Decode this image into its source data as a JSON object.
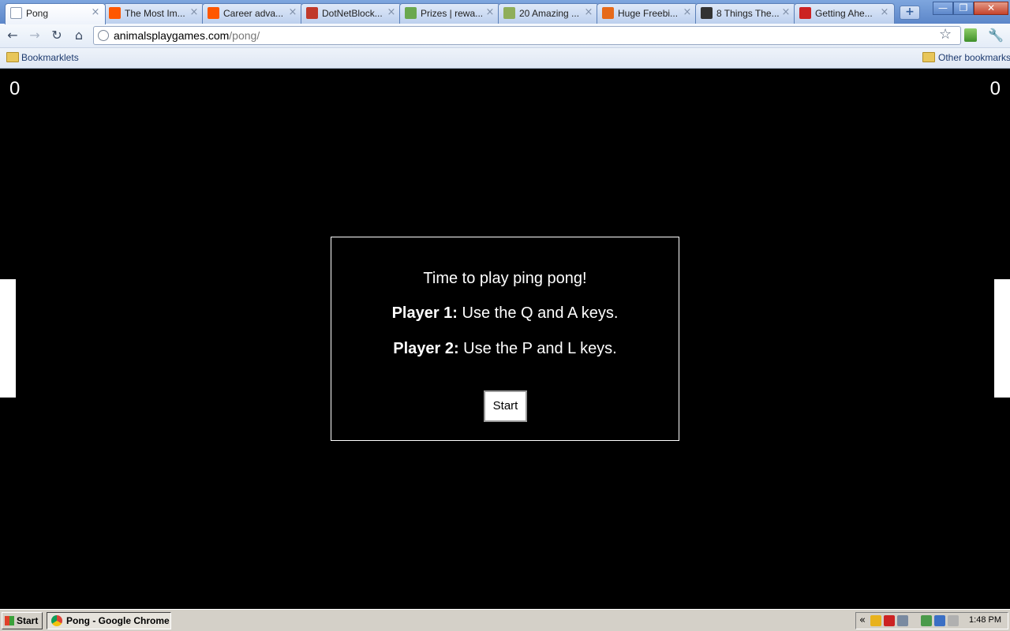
{
  "browser": {
    "tabs": [
      {
        "title": "Pong",
        "active": true,
        "icon": "page-icon",
        "icon_color": "#ffffff"
      },
      {
        "title": "The Most Im...",
        "active": false,
        "icon": "reddit-alien-icon",
        "icon_color": "#ff5700"
      },
      {
        "title": "Career adva...",
        "active": false,
        "icon": "reddit-alien-icon",
        "icon_color": "#ff5700"
      },
      {
        "title": "DotNetBlock...",
        "active": false,
        "icon": "key-icon",
        "icon_color": "#c0392b"
      },
      {
        "title": "Prizes | rewa...",
        "active": false,
        "icon": "prize-icon",
        "icon_color": "#6aa84f"
      },
      {
        "title": "20 Amazing ...",
        "active": false,
        "icon": "d-letter-icon",
        "icon_color": "#8fae5a"
      },
      {
        "title": "Huge Freebi...",
        "active": false,
        "icon": "flame-icon",
        "icon_color": "#e66a1a"
      },
      {
        "title": "8 Things The...",
        "active": false,
        "icon": "sr-icon",
        "icon_color": "#333333"
      },
      {
        "title": "Getting Ahe...",
        "active": false,
        "icon": "s-logo-icon",
        "icon_color": "#cc2222"
      }
    ],
    "url_host": "animalsplaygames.com",
    "url_path": "/pong/",
    "bookmarks": {
      "left_folder": "Bookmarklets",
      "right_folder": "Other bookmarks"
    }
  },
  "game": {
    "score_left": "0",
    "score_right": "0",
    "dialog": {
      "intro": "Time to play ping pong!",
      "p1_label": "Player 1:",
      "p1_text": " Use the Q and A keys.",
      "p2_label": "Player 2:",
      "p2_text": " Use the P and L keys.",
      "start_label": "Start"
    }
  },
  "taskbar": {
    "start_label": "Start",
    "window_label": "Pong - Google Chrome",
    "tray_chevron": "«",
    "clock": "1:48 PM"
  }
}
